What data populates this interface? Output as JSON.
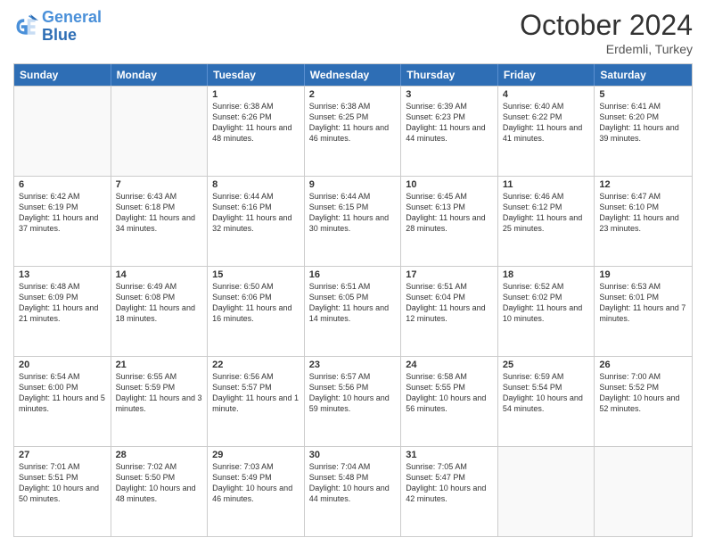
{
  "header": {
    "logo_line1": "General",
    "logo_line2": "Blue",
    "month": "October 2024",
    "location": "Erdemli, Turkey"
  },
  "weekdays": [
    "Sunday",
    "Monday",
    "Tuesday",
    "Wednesday",
    "Thursday",
    "Friday",
    "Saturday"
  ],
  "weeks": [
    [
      {
        "day": "",
        "info": ""
      },
      {
        "day": "",
        "info": ""
      },
      {
        "day": "1",
        "info": "Sunrise: 6:38 AM\nSunset: 6:26 PM\nDaylight: 11 hours and 48 minutes."
      },
      {
        "day": "2",
        "info": "Sunrise: 6:38 AM\nSunset: 6:25 PM\nDaylight: 11 hours and 46 minutes."
      },
      {
        "day": "3",
        "info": "Sunrise: 6:39 AM\nSunset: 6:23 PM\nDaylight: 11 hours and 44 minutes."
      },
      {
        "day": "4",
        "info": "Sunrise: 6:40 AM\nSunset: 6:22 PM\nDaylight: 11 hours and 41 minutes."
      },
      {
        "day": "5",
        "info": "Sunrise: 6:41 AM\nSunset: 6:20 PM\nDaylight: 11 hours and 39 minutes."
      }
    ],
    [
      {
        "day": "6",
        "info": "Sunrise: 6:42 AM\nSunset: 6:19 PM\nDaylight: 11 hours and 37 minutes."
      },
      {
        "day": "7",
        "info": "Sunrise: 6:43 AM\nSunset: 6:18 PM\nDaylight: 11 hours and 34 minutes."
      },
      {
        "day": "8",
        "info": "Sunrise: 6:44 AM\nSunset: 6:16 PM\nDaylight: 11 hours and 32 minutes."
      },
      {
        "day": "9",
        "info": "Sunrise: 6:44 AM\nSunset: 6:15 PM\nDaylight: 11 hours and 30 minutes."
      },
      {
        "day": "10",
        "info": "Sunrise: 6:45 AM\nSunset: 6:13 PM\nDaylight: 11 hours and 28 minutes."
      },
      {
        "day": "11",
        "info": "Sunrise: 6:46 AM\nSunset: 6:12 PM\nDaylight: 11 hours and 25 minutes."
      },
      {
        "day": "12",
        "info": "Sunrise: 6:47 AM\nSunset: 6:10 PM\nDaylight: 11 hours and 23 minutes."
      }
    ],
    [
      {
        "day": "13",
        "info": "Sunrise: 6:48 AM\nSunset: 6:09 PM\nDaylight: 11 hours and 21 minutes."
      },
      {
        "day": "14",
        "info": "Sunrise: 6:49 AM\nSunset: 6:08 PM\nDaylight: 11 hours and 18 minutes."
      },
      {
        "day": "15",
        "info": "Sunrise: 6:50 AM\nSunset: 6:06 PM\nDaylight: 11 hours and 16 minutes."
      },
      {
        "day": "16",
        "info": "Sunrise: 6:51 AM\nSunset: 6:05 PM\nDaylight: 11 hours and 14 minutes."
      },
      {
        "day": "17",
        "info": "Sunrise: 6:51 AM\nSunset: 6:04 PM\nDaylight: 11 hours and 12 minutes."
      },
      {
        "day": "18",
        "info": "Sunrise: 6:52 AM\nSunset: 6:02 PM\nDaylight: 11 hours and 10 minutes."
      },
      {
        "day": "19",
        "info": "Sunrise: 6:53 AM\nSunset: 6:01 PM\nDaylight: 11 hours and 7 minutes."
      }
    ],
    [
      {
        "day": "20",
        "info": "Sunrise: 6:54 AM\nSunset: 6:00 PM\nDaylight: 11 hours and 5 minutes."
      },
      {
        "day": "21",
        "info": "Sunrise: 6:55 AM\nSunset: 5:59 PM\nDaylight: 11 hours and 3 minutes."
      },
      {
        "day": "22",
        "info": "Sunrise: 6:56 AM\nSunset: 5:57 PM\nDaylight: 11 hours and 1 minute."
      },
      {
        "day": "23",
        "info": "Sunrise: 6:57 AM\nSunset: 5:56 PM\nDaylight: 10 hours and 59 minutes."
      },
      {
        "day": "24",
        "info": "Sunrise: 6:58 AM\nSunset: 5:55 PM\nDaylight: 10 hours and 56 minutes."
      },
      {
        "day": "25",
        "info": "Sunrise: 6:59 AM\nSunset: 5:54 PM\nDaylight: 10 hours and 54 minutes."
      },
      {
        "day": "26",
        "info": "Sunrise: 7:00 AM\nSunset: 5:52 PM\nDaylight: 10 hours and 52 minutes."
      }
    ],
    [
      {
        "day": "27",
        "info": "Sunrise: 7:01 AM\nSunset: 5:51 PM\nDaylight: 10 hours and 50 minutes."
      },
      {
        "day": "28",
        "info": "Sunrise: 7:02 AM\nSunset: 5:50 PM\nDaylight: 10 hours and 48 minutes."
      },
      {
        "day": "29",
        "info": "Sunrise: 7:03 AM\nSunset: 5:49 PM\nDaylight: 10 hours and 46 minutes."
      },
      {
        "day": "30",
        "info": "Sunrise: 7:04 AM\nSunset: 5:48 PM\nDaylight: 10 hours and 44 minutes."
      },
      {
        "day": "31",
        "info": "Sunrise: 7:05 AM\nSunset: 5:47 PM\nDaylight: 10 hours and 42 minutes."
      },
      {
        "day": "",
        "info": ""
      },
      {
        "day": "",
        "info": ""
      }
    ]
  ]
}
